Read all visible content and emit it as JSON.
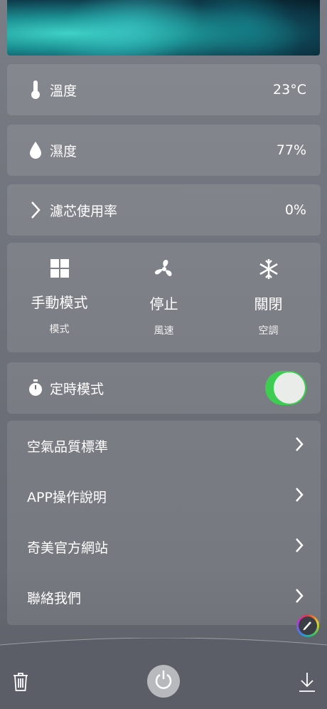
{
  "readings": {
    "temperature": {
      "label": "溫度",
      "value": "23°C",
      "icon": "thermometer-icon"
    },
    "humidity": {
      "label": "濕度",
      "value": "77%",
      "icon": "water-drop-icon"
    },
    "filter": {
      "label": "濾芯使用率",
      "value": "0%",
      "icon": "chevron-right-icon"
    }
  },
  "modes": [
    {
      "title": "手動模式",
      "sub": "模式",
      "icon": "grid-icon"
    },
    {
      "title": "停止",
      "sub": "風速",
      "icon": "fan-icon"
    },
    {
      "title": "關閉",
      "sub": "空調",
      "icon": "snowflake-icon"
    }
  ],
  "timer": {
    "label": "定時模式",
    "on": true,
    "icon": "stopwatch-icon"
  },
  "links": [
    {
      "label": "空氣品質標準"
    },
    {
      "label": "APP操作說明"
    },
    {
      "label": "奇美官方網站"
    },
    {
      "label": "聯絡我們"
    }
  ],
  "colors": {
    "toggle_on": "#3ecd52",
    "background": "#6f727a"
  },
  "bottom_bar": {
    "left_icon": "trash-icon",
    "center_icon": "power-icon",
    "right_icon": "download-icon",
    "fab_icon": "pen-icon"
  }
}
